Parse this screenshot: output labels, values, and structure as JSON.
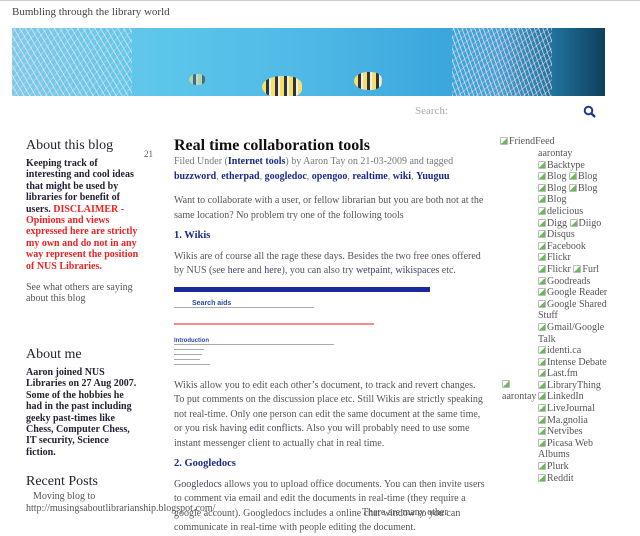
{
  "header": {
    "tagline": "Bumbling through the library world",
    "search_label": "Search:"
  },
  "left": {
    "about_title": "About this blog",
    "about_text": "Keeping track of interesting and cool ideas that might be used by libraries for benefit of users. ",
    "disclaimer": "DISCLAIMER - Opinions and views expressed here are strictly my own and do not in any way represent the position of NUS Libraries.",
    "see_others": "See what others are saying about this blog",
    "aboutme_title": "About me",
    "aboutme_text": "Aaron joined NUS Libraries on 27 Aug 2007. Some of the hobbies he had in the past including geeky past-times like Chess, Computer Chess, IT security, Science fiction.",
    "recent_title": "Recent Posts",
    "recent_item": "Moving blog to http://musingsaboutlibrarianship.blogspot.com/"
  },
  "post": {
    "day": "21",
    "title": "Real time collaboration tools",
    "filed_prefix": "Filed Under (",
    "category": "Internet tools",
    "filed_suffix": ") by Aaron Tay on 21-03-2009 and tagged",
    "tags": [
      "buzzword",
      "etherpad",
      "googledoc",
      "opengoo",
      "realtime",
      "wiki",
      "Yuuguu"
    ],
    "intro": "Want to collaborate with a user, or fellow librarian but you are both not at the same location? No problem try one of the following tools",
    "h1": "1. Wikis",
    "p1a": "Wikis are of course all the rage these days. Besides the two free ones offered by NUS (see ",
    "here1": "here",
    "and": " and ",
    "here2": "here",
    "p1b": "), you can also try ",
    "wetpaint": "wetpaint",
    "wikispaces": "wikispaces",
    "etc": "etc.",
    "screenshot": {
      "title": "Search aids",
      "intro": "Introduction"
    },
    "p2a": "Wikis allow you to edit each other’s document, to track and revert changes. To put comments on the discussion place etc. Still Wikis are strictly speaking not real-time. Only one person can edit the same document at the same time, or you risk having ",
    "edit_conflicts": "edit conflicts",
    "p2b": ". Also you will probably need to use some instant messenger client to actually chat in real time.",
    "h2": "2. Googledocs",
    "googledocs": "Googledocs",
    "p3": " allows you to upload office documents. You can then invite users to comment via email and edit the documents in real-time (they require a google account). Googledocs includes a online chat window so you can communicate in real-time with people editing the document.",
    "more": "There are many other"
  },
  "right": {
    "friendfeed": "FriendFeed",
    "user": "aarontay",
    "avatar_label": "aarontay",
    "services": [
      [
        "Backtype"
      ],
      [
        "Blog",
        "Blog"
      ],
      [
        "Blog",
        "Blog"
      ],
      [
        "Blog"
      ],
      [
        "delicious"
      ],
      [
        "Digg",
        "Diigo"
      ],
      [
        "Disqus"
      ],
      [
        "Facebook"
      ],
      [
        "Flickr"
      ],
      [
        "Flickr",
        "Furl"
      ],
      [
        "Goodreads"
      ],
      [
        "Google Reader"
      ],
      [
        "Google Shared Stuff"
      ],
      [
        "Gmail/Google Talk"
      ],
      [
        "identi.ca"
      ],
      [
        "Intense Debate"
      ],
      [
        "Last.fm"
      ],
      [
        "LibraryThing"
      ],
      [
        "LinkedIn"
      ],
      [
        "LiveJournal"
      ],
      [
        "Ma.gnolia"
      ],
      [
        "Netvibes"
      ],
      [
        "Picasa Web Albums"
      ],
      [
        "Plurk"
      ],
      [
        "Reddit"
      ]
    ]
  }
}
